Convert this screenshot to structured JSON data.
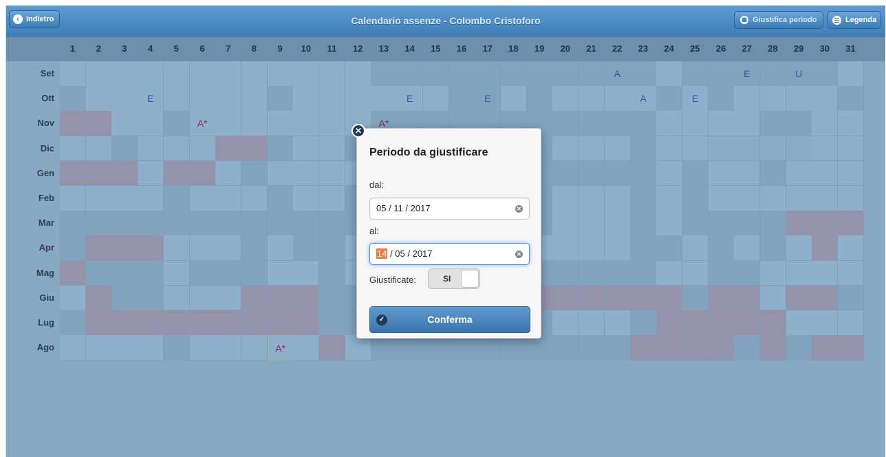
{
  "header": {
    "back_label": "Indietro",
    "title": "Calendario assenze - Colombo Cristoforo",
    "justify_label": "Giustifica periodo",
    "legend_label": "Legenda"
  },
  "days": [
    "1",
    "2",
    "3",
    "4",
    "5",
    "6",
    "7",
    "8",
    "9",
    "10",
    "11",
    "12",
    "13",
    "14",
    "15",
    "16",
    "17",
    "18",
    "19",
    "20",
    "21",
    "22",
    "23",
    "24",
    "25",
    "26",
    "27",
    "28",
    "29",
    "30",
    "31"
  ],
  "months": [
    "Set",
    "Ott",
    "Nov",
    "Dic",
    "Gen",
    "Feb",
    "Mar",
    "Apr",
    "Mag",
    "Giu",
    "Lug",
    "Ago"
  ],
  "colors": {
    "cell_light": "#8eb0cb",
    "cell_dark": "#81a3be",
    "cell_holiday": "#9592ab"
  },
  "grid_rows": [
    "00000000000011111111111011111101",
    "1000000010000001101000010100001",
    "2200100000001111111111100001100",
    "0010002210011111111000100333300",
    "2220220100000111111111101001000",
    "0000100010010111111000101000000",
    "1111111111110111111000101111222",
    "1222000101100011100000110101020",
    "2111011100100111111111100110000",
    "0211000222111111222222221220221",
    "1222222222111111111000122222000",
    "0000100000201111111111222212122"
  ],
  "marks": [
    {
      "row": 0,
      "day": 22,
      "text": "A",
      "color": "blue"
    },
    {
      "row": 0,
      "day": 27,
      "text": "E",
      "color": "blue"
    },
    {
      "row": 0,
      "day": 29,
      "text": "U",
      "color": "blue"
    },
    {
      "row": 1,
      "day": 4,
      "text": "E",
      "color": "blue"
    },
    {
      "row": 1,
      "day": 14,
      "text": "E",
      "color": "blue"
    },
    {
      "row": 1,
      "day": 17,
      "text": "E",
      "color": "blue"
    },
    {
      "row": 1,
      "day": 23,
      "text": "A",
      "color": "blue"
    },
    {
      "row": 1,
      "day": 25,
      "text": "E",
      "color": "blue"
    },
    {
      "row": 2,
      "day": 6,
      "text": "A*",
      "color": "red"
    },
    {
      "row": 2,
      "day": 13,
      "text": "A*",
      "color": "red"
    },
    {
      "row": 11,
      "day": 9,
      "text": "A*",
      "color": "red",
      "outlined": true
    }
  ],
  "dialog": {
    "title": "Periodo da giustificare",
    "from_label": "dal:",
    "from_value": "05 / 11 / 2017",
    "to_label": "al:",
    "to_day": "14",
    "to_rest": " / 05 / 2017",
    "justified_label": "Giustificate:",
    "toggle_label": "SI",
    "confirm_label": "Conferma"
  }
}
